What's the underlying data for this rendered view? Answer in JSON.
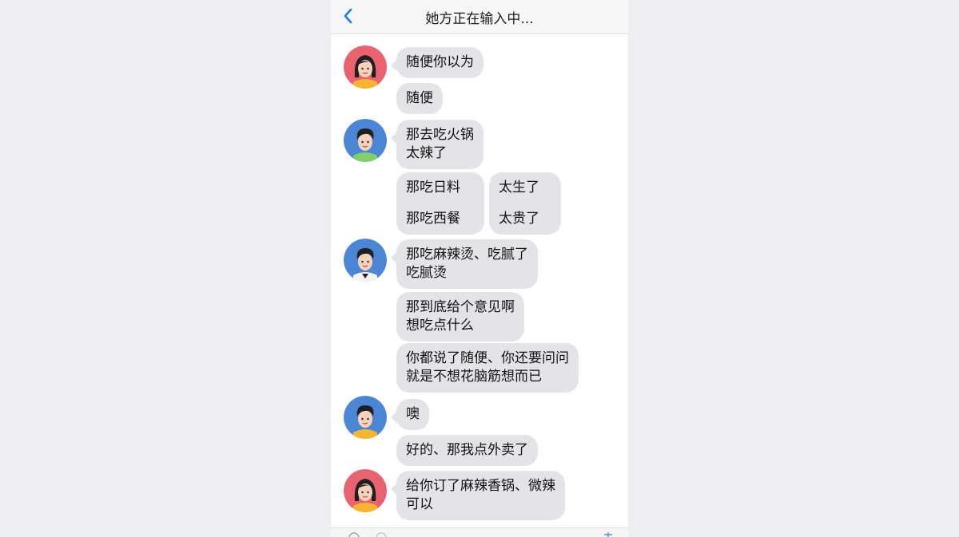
{
  "header": {
    "title": "她方正在输入中..."
  },
  "messages": [
    {
      "sender": "her",
      "lines": [
        "随便你以为"
      ]
    },
    {
      "sender": "her",
      "lines": [
        "随便"
      ]
    },
    {
      "sender": "him",
      "lines": [
        "那去吃火锅",
        "太辣了"
      ]
    },
    {
      "sender": "him",
      "lines": [
        "那吃日料",
        "那吃西餐"
      ]
    },
    {
      "sender": "her",
      "lines": [
        "太生了",
        "太贵了"
      ]
    },
    {
      "sender": "him",
      "lines": [
        "那吃麻辣烫、吃腻了",
        "吃腻烫"
      ]
    },
    {
      "sender": "him",
      "lines": [
        "那到底给个意见啊",
        "想吃点什么"
      ]
    },
    {
      "sender": "him",
      "lines": [
        "你都说了随便、你还要问问",
        "就是不想花脑筋想而已"
      ]
    },
    {
      "sender": "him",
      "lines": [
        "噢"
      ]
    },
    {
      "sender": "him",
      "lines": [
        "好的、那我点外卖了"
      ]
    },
    {
      "sender": "her",
      "lines": [
        "给你订了麻辣香锅、微辣",
        "可以"
      ]
    }
  ],
  "avatars": {
    "her_icon": "female-avatar-icon",
    "him_icon": "male-avatar-icon"
  },
  "colors": {
    "accent": "#1a7cf5",
    "bubble": "#e3e4e8",
    "her_avatar_bg": "#e9626f",
    "him_avatar_bg": "#4a86d4"
  }
}
